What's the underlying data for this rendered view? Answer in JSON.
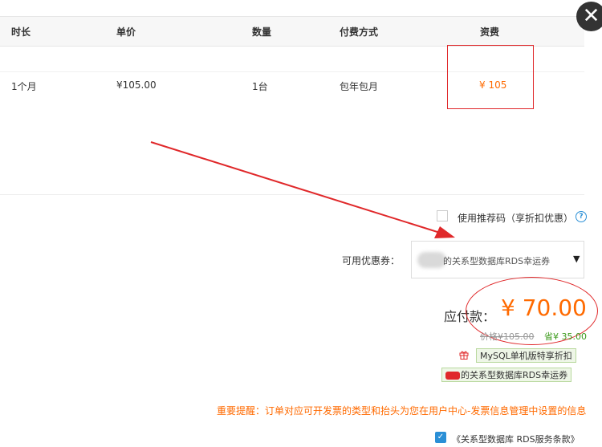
{
  "window": {
    "close_glyph": "✕"
  },
  "table": {
    "headers": {
      "duration": "时长",
      "unit_price": "单价",
      "quantity": "数量",
      "payment_method": "付费方式",
      "fee": "资费"
    },
    "row": {
      "duration": "1个月",
      "unit_price": "¥105.00",
      "quantity": "1台",
      "payment_method": "包年包月",
      "fee": "¥ 105"
    }
  },
  "promo": {
    "checkbox_label": "使用推荐码（享折扣优惠）",
    "help_glyph": "?"
  },
  "coupon": {
    "label": "可用优惠券：",
    "selected": "的关系型数据库RDS幸运券",
    "arrow": "▼"
  },
  "payment": {
    "due_label": "应付款：",
    "due_amount": "¥ 70.00",
    "original_price": "价格¥105.00",
    "saved": "省¥ 35.00"
  },
  "discounts": {
    "gift_glyph": "🎁",
    "tag1": "MySQL单机版特享折扣",
    "tag2": "的关系型数据库RDS幸运券"
  },
  "notice": "重要提醒：订单对应可开发票的类型和抬头为您在用户中心-发票信息管理中设置的信息",
  "agreement": {
    "check_glyph": "✓",
    "text": "《关系型数据库 RDS服务条款》"
  },
  "colors": {
    "accent_orange": "#ff6a00",
    "annotation_red": "#e0282a",
    "link_blue": "#2a8fd6",
    "save_green": "#3c9a1c"
  }
}
